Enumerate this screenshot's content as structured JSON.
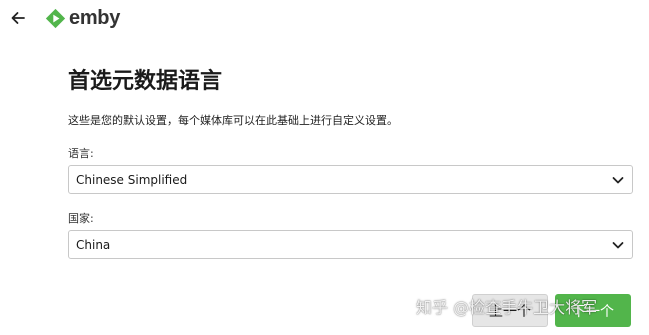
{
  "header": {
    "back_icon": "arrow-left-icon",
    "logo_text": "emby",
    "logo_color": "#52b54b"
  },
  "main": {
    "title": "首选元数据语言",
    "subtitle": "这些是您的默认设置，每个媒体库可以在此基础上进行自定义设置。",
    "language": {
      "label": "语言:",
      "value": "Chinese Simplified"
    },
    "country": {
      "label": "国家:",
      "value": "China"
    }
  },
  "footer": {
    "prev_label": "上一个",
    "next_label": "下一个",
    "next_color": "#52b54b"
  },
  "watermark": "知乎 @检查手牛卫大将军"
}
